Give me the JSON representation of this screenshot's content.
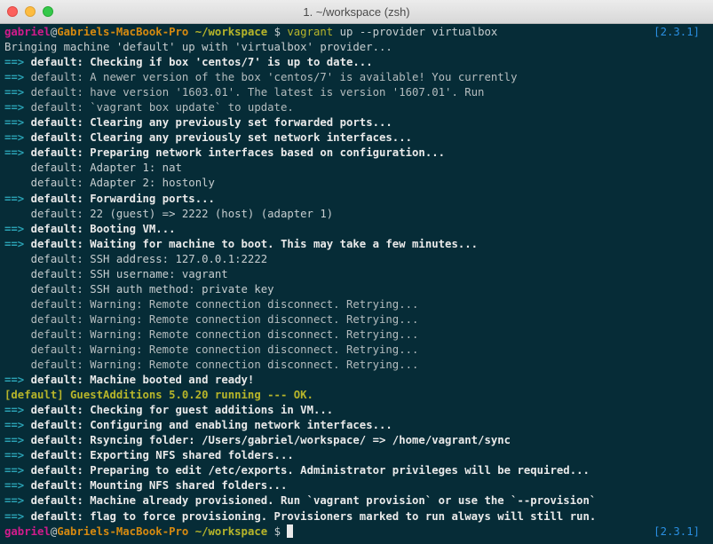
{
  "window": {
    "title": "1. ~/workspace (zsh)"
  },
  "prompt": {
    "user": "gabriel",
    "at": "@",
    "host": "Gabriels-MacBook-Pro",
    "path": "~/workspace",
    "symbol": "$",
    "version": "[2.3.1]"
  },
  "command": {
    "name": "vagrant",
    "args": "up --provider virtualbox"
  },
  "output": {
    "intro": "Bringing machine 'default' up with 'virtualbox' provider...",
    "arrow": "==>",
    "msgs": [
      "default: Checking if box 'centos/7' is up to date...",
      "default: A newer version of the box 'centos/7' is available! You currently",
      "default: have version '1603.01'. The latest is version '1607.01'. Run",
      "default: `vagrant box update` to update.",
      "default: Clearing any previously set forwarded ports...",
      "default: Clearing any previously set network interfaces...",
      "default: Preparing network interfaces based on configuration...",
      "    default: Adapter 1: nat",
      "    default: Adapter 2: hostonly",
      "default: Forwarding ports...",
      "    default: 22 (guest) => 2222 (host) (adapter 1)",
      "default: Booting VM...",
      "default: Waiting for machine to boot. This may take a few minutes...",
      "    default: SSH address: 127.0.0.1:2222",
      "    default: SSH username: vagrant",
      "    default: SSH auth method: private key",
      "    default: Warning: Remote connection disconnect. Retrying...",
      "    default: Warning: Remote connection disconnect. Retrying...",
      "    default: Warning: Remote connection disconnect. Retrying...",
      "    default: Warning: Remote connection disconnect. Retrying...",
      "    default: Warning: Remote connection disconnect. Retrying...",
      "default: Machine booted and ready!",
      "[default] GuestAdditions 5.0.20 running --- OK.",
      "default: Checking for guest additions in VM...",
      "default: Configuring and enabling network interfaces...",
      "default: Rsyncing folder: /Users/gabriel/workspace/ => /home/vagrant/sync",
      "default: Exporting NFS shared folders...",
      "default: Preparing to edit /etc/exports. Administrator privileges will be required...",
      "default: Mounting NFS shared folders...",
      "default: Machine already provisioned. Run `vagrant provision` or use the `--provision`",
      "default: flag to force provisioning. Provisioners marked to run always will still run."
    ]
  },
  "colors": {
    "background": "#062c37",
    "arrow": "#2aa1b3",
    "user": "#d11c8c",
    "host": "#d68a10",
    "path": "#b7b52a",
    "version": "#2a8ee0"
  }
}
